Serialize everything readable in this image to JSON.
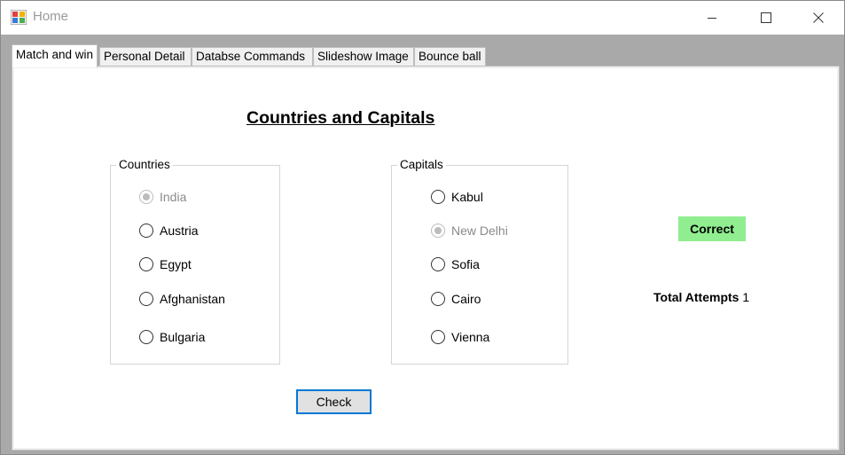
{
  "window": {
    "title": "Home"
  },
  "tabs": [
    {
      "label": "Match and win",
      "active": true
    },
    {
      "label": "Personal Detail",
      "active": false
    },
    {
      "label": "Databse Commands",
      "active": false
    },
    {
      "label": "Slideshow Image",
      "active": false
    },
    {
      "label": "Bounce ball",
      "active": false
    }
  ],
  "main": {
    "heading": "Countries and Capitals",
    "countries": {
      "caption": "Countries",
      "options": [
        {
          "label": "India",
          "checked": true,
          "disabled": true
        },
        {
          "label": "Austria",
          "checked": false,
          "disabled": false
        },
        {
          "label": "Egypt",
          "checked": false,
          "disabled": false
        },
        {
          "label": "Afghanistan",
          "checked": false,
          "disabled": false
        },
        {
          "label": "Bulgaria",
          "checked": false,
          "disabled": false
        }
      ]
    },
    "capitals": {
      "caption": "Capitals",
      "options": [
        {
          "label": "Kabul",
          "checked": false,
          "disabled": false
        },
        {
          "label": "New Delhi",
          "checked": true,
          "disabled": true
        },
        {
          "label": "Sofia",
          "checked": false,
          "disabled": false
        },
        {
          "label": "Cairo",
          "checked": false,
          "disabled": false
        },
        {
          "label": "Vienna",
          "checked": false,
          "disabled": false
        }
      ]
    },
    "result": "Correct",
    "attempts_label": "Total Attempts",
    "attempts_value": "1",
    "check_button": "Check"
  },
  "colors": {
    "correct_bg": "#90ee90",
    "focus_border": "#0078d7",
    "client_bg": "#a9a9a9"
  }
}
